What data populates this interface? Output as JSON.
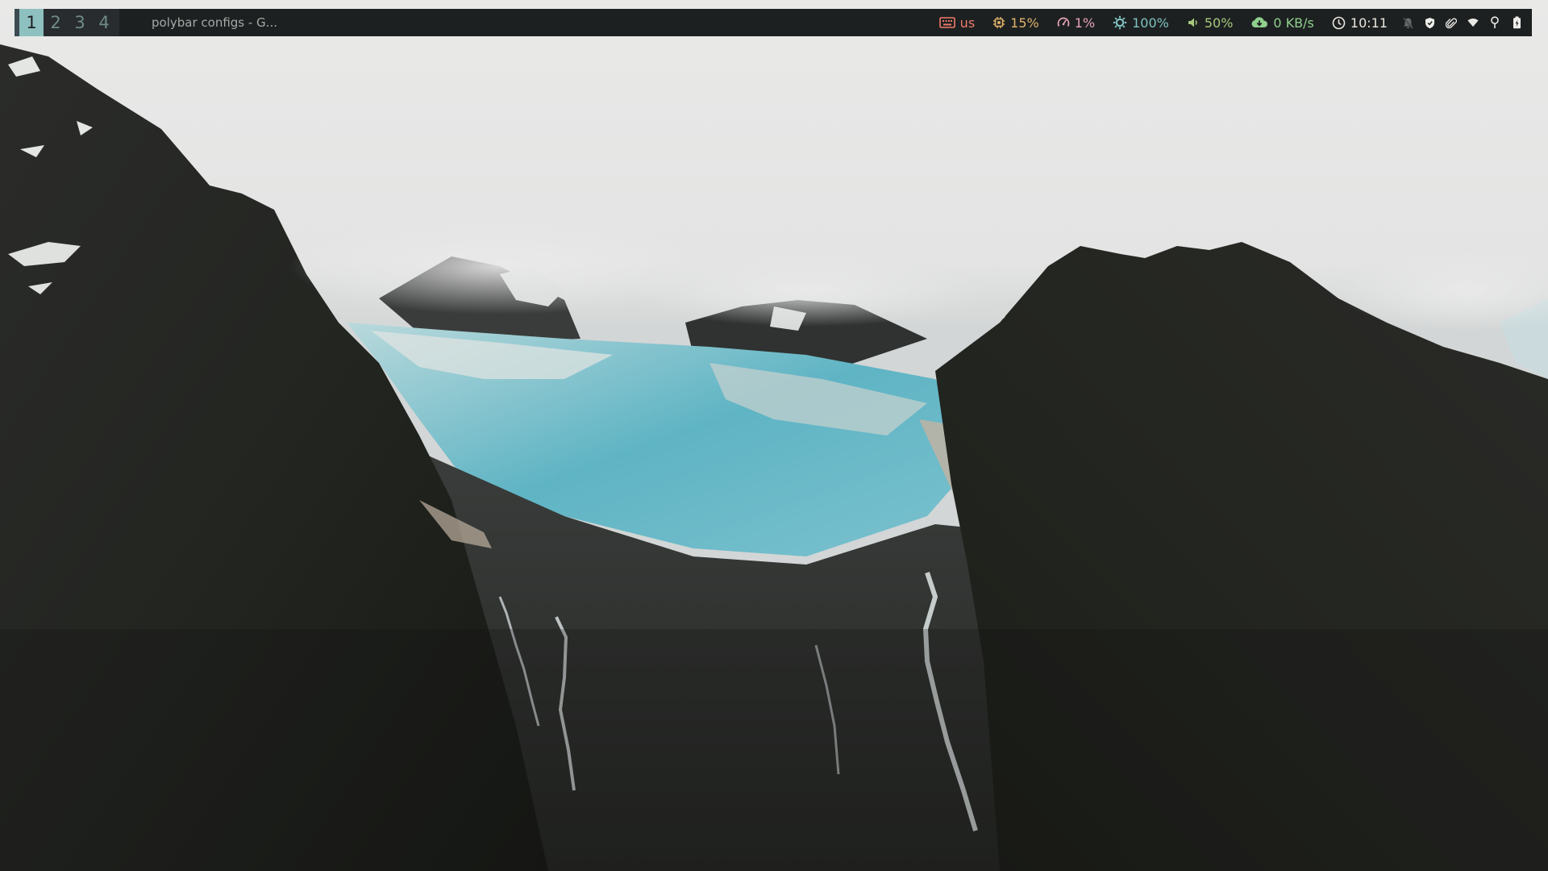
{
  "workspaces": [
    {
      "label": "1",
      "active": true
    },
    {
      "label": "2",
      "active": false
    },
    {
      "label": "3",
      "active": false
    },
    {
      "label": "4",
      "active": false
    }
  ],
  "window_title": "polybar configs - G...",
  "modules": {
    "keyboard": {
      "icon": "keyboard-icon",
      "value": "us",
      "color": "#f07a6a"
    },
    "cpu": {
      "icon": "cpu-icon",
      "value": "15%",
      "color": "#e2b36a"
    },
    "memory": {
      "icon": "gauge-icon",
      "value": "1%",
      "color": "#e6a3b6"
    },
    "brightness": {
      "icon": "brightness-icon",
      "value": "100%",
      "color": "#7fc3c2"
    },
    "volume": {
      "icon": "speaker-icon",
      "value": "50%",
      "color": "#a7c97e"
    },
    "network": {
      "icon": "cloud-download-icon",
      "value": "0 KB/s",
      "color": "#8fd08c"
    },
    "clock": {
      "icon": "clock-icon",
      "value": "10:11",
      "color": "#ece8df"
    }
  },
  "tray": [
    "bell-off-icon",
    "shield-icon",
    "paperclip-icon",
    "wifi-icon",
    "location-pin-icon",
    "battery-icon"
  ],
  "colors": {
    "bar_background": "#1d2021",
    "workspace_active_bg": "#8ec0c0",
    "workspace_inactive_fg": "#6f8b87"
  }
}
